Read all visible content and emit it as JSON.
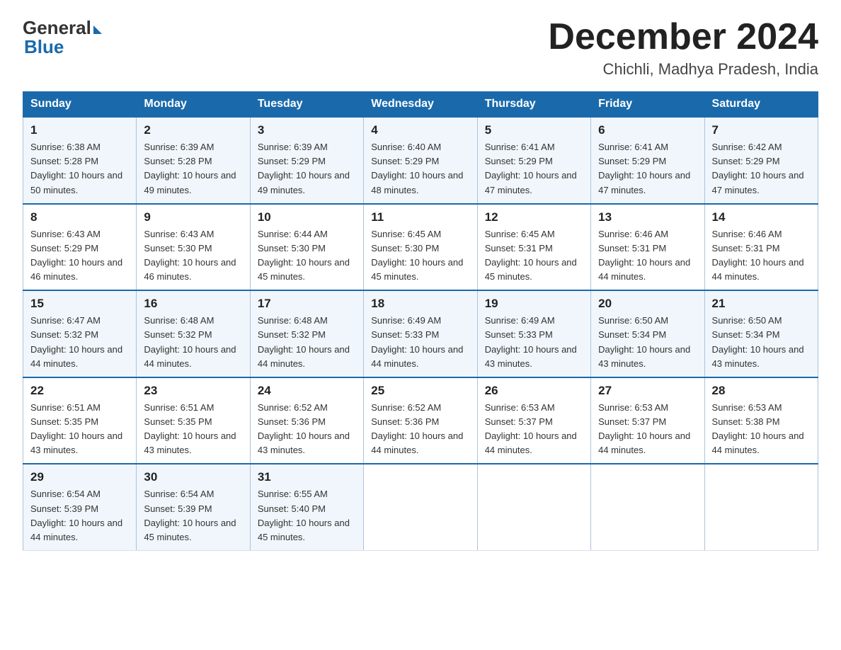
{
  "header": {
    "logo_general": "General",
    "logo_blue": "Blue",
    "month_title": "December 2024",
    "location": "Chichli, Madhya Pradesh, India"
  },
  "days_of_week": [
    "Sunday",
    "Monday",
    "Tuesday",
    "Wednesday",
    "Thursday",
    "Friday",
    "Saturday"
  ],
  "weeks": [
    [
      {
        "day": 1,
        "sunrise": "6:38 AM",
        "sunset": "5:28 PM",
        "daylight": "10 hours and 50 minutes."
      },
      {
        "day": 2,
        "sunrise": "6:39 AM",
        "sunset": "5:28 PM",
        "daylight": "10 hours and 49 minutes."
      },
      {
        "day": 3,
        "sunrise": "6:39 AM",
        "sunset": "5:29 PM",
        "daylight": "10 hours and 49 minutes."
      },
      {
        "day": 4,
        "sunrise": "6:40 AM",
        "sunset": "5:29 PM",
        "daylight": "10 hours and 48 minutes."
      },
      {
        "day": 5,
        "sunrise": "6:41 AM",
        "sunset": "5:29 PM",
        "daylight": "10 hours and 47 minutes."
      },
      {
        "day": 6,
        "sunrise": "6:41 AM",
        "sunset": "5:29 PM",
        "daylight": "10 hours and 47 minutes."
      },
      {
        "day": 7,
        "sunrise": "6:42 AM",
        "sunset": "5:29 PM",
        "daylight": "10 hours and 47 minutes."
      }
    ],
    [
      {
        "day": 8,
        "sunrise": "6:43 AM",
        "sunset": "5:29 PM",
        "daylight": "10 hours and 46 minutes."
      },
      {
        "day": 9,
        "sunrise": "6:43 AM",
        "sunset": "5:30 PM",
        "daylight": "10 hours and 46 minutes."
      },
      {
        "day": 10,
        "sunrise": "6:44 AM",
        "sunset": "5:30 PM",
        "daylight": "10 hours and 45 minutes."
      },
      {
        "day": 11,
        "sunrise": "6:45 AM",
        "sunset": "5:30 PM",
        "daylight": "10 hours and 45 minutes."
      },
      {
        "day": 12,
        "sunrise": "6:45 AM",
        "sunset": "5:31 PM",
        "daylight": "10 hours and 45 minutes."
      },
      {
        "day": 13,
        "sunrise": "6:46 AM",
        "sunset": "5:31 PM",
        "daylight": "10 hours and 44 minutes."
      },
      {
        "day": 14,
        "sunrise": "6:46 AM",
        "sunset": "5:31 PM",
        "daylight": "10 hours and 44 minutes."
      }
    ],
    [
      {
        "day": 15,
        "sunrise": "6:47 AM",
        "sunset": "5:32 PM",
        "daylight": "10 hours and 44 minutes."
      },
      {
        "day": 16,
        "sunrise": "6:48 AM",
        "sunset": "5:32 PM",
        "daylight": "10 hours and 44 minutes."
      },
      {
        "day": 17,
        "sunrise": "6:48 AM",
        "sunset": "5:32 PM",
        "daylight": "10 hours and 44 minutes."
      },
      {
        "day": 18,
        "sunrise": "6:49 AM",
        "sunset": "5:33 PM",
        "daylight": "10 hours and 44 minutes."
      },
      {
        "day": 19,
        "sunrise": "6:49 AM",
        "sunset": "5:33 PM",
        "daylight": "10 hours and 43 minutes."
      },
      {
        "day": 20,
        "sunrise": "6:50 AM",
        "sunset": "5:34 PM",
        "daylight": "10 hours and 43 minutes."
      },
      {
        "day": 21,
        "sunrise": "6:50 AM",
        "sunset": "5:34 PM",
        "daylight": "10 hours and 43 minutes."
      }
    ],
    [
      {
        "day": 22,
        "sunrise": "6:51 AM",
        "sunset": "5:35 PM",
        "daylight": "10 hours and 43 minutes."
      },
      {
        "day": 23,
        "sunrise": "6:51 AM",
        "sunset": "5:35 PM",
        "daylight": "10 hours and 43 minutes."
      },
      {
        "day": 24,
        "sunrise": "6:52 AM",
        "sunset": "5:36 PM",
        "daylight": "10 hours and 43 minutes."
      },
      {
        "day": 25,
        "sunrise": "6:52 AM",
        "sunset": "5:36 PM",
        "daylight": "10 hours and 44 minutes."
      },
      {
        "day": 26,
        "sunrise": "6:53 AM",
        "sunset": "5:37 PM",
        "daylight": "10 hours and 44 minutes."
      },
      {
        "day": 27,
        "sunrise": "6:53 AM",
        "sunset": "5:37 PM",
        "daylight": "10 hours and 44 minutes."
      },
      {
        "day": 28,
        "sunrise": "6:53 AM",
        "sunset": "5:38 PM",
        "daylight": "10 hours and 44 minutes."
      }
    ],
    [
      {
        "day": 29,
        "sunrise": "6:54 AM",
        "sunset": "5:39 PM",
        "daylight": "10 hours and 44 minutes."
      },
      {
        "day": 30,
        "sunrise": "6:54 AM",
        "sunset": "5:39 PM",
        "daylight": "10 hours and 45 minutes."
      },
      {
        "day": 31,
        "sunrise": "6:55 AM",
        "sunset": "5:40 PM",
        "daylight": "10 hours and 45 minutes."
      },
      null,
      null,
      null,
      null
    ]
  ]
}
